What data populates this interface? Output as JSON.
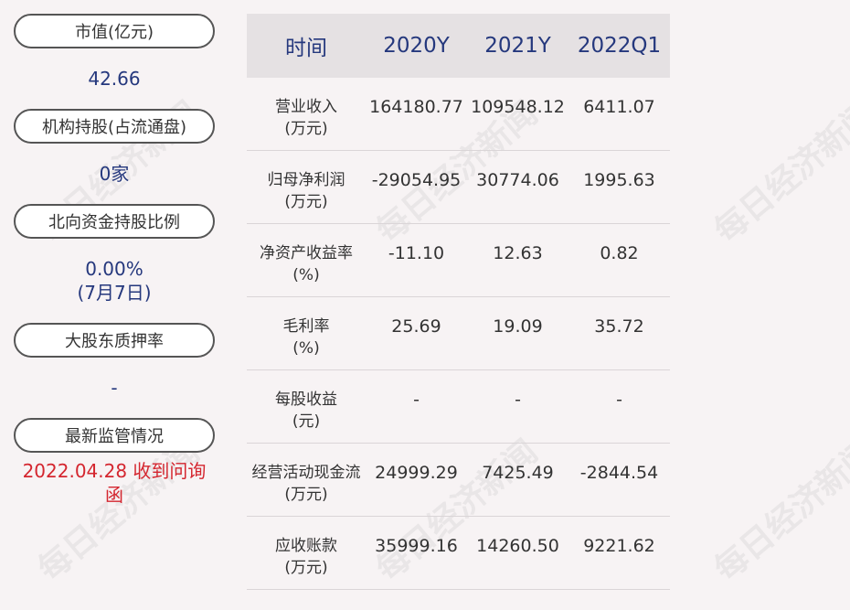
{
  "left": {
    "items": [
      {
        "label": "市值(亿元)",
        "value": "42.66"
      },
      {
        "label": "机构持股(占流通盘)",
        "value": "0家"
      },
      {
        "label": "北向资金持股比例",
        "value": "0.00%",
        "value2": "(7月7日)"
      },
      {
        "label": "大股东质押率",
        "value": "-"
      },
      {
        "label": "最新监管情况",
        "value": "2022.04.28 收到问询函"
      }
    ]
  },
  "table": {
    "headers": [
      "时间",
      "2020Y",
      "2021Y",
      "2022Q1"
    ],
    "rows": [
      {
        "label": "营业收入",
        "unit": "(万元)",
        "values": [
          "164180.77",
          "109548.12",
          "6411.07"
        ]
      },
      {
        "label": "归母净利润",
        "unit": "(万元)",
        "values": [
          "-29054.95",
          "30774.06",
          "1995.63"
        ]
      },
      {
        "label": "净资产收益率",
        "unit": "(%)",
        "values": [
          "-11.10",
          "12.63",
          "0.82"
        ]
      },
      {
        "label": "毛利率",
        "unit": "(%)",
        "values": [
          "25.69",
          "19.09",
          "35.72"
        ]
      },
      {
        "label": "每股收益",
        "unit": "(元)",
        "values": [
          "-",
          "-",
          "-"
        ]
      },
      {
        "label": "经营活动现金流",
        "unit": "(万元)",
        "values": [
          "24999.29",
          "7425.49",
          "-2844.54"
        ]
      },
      {
        "label": "应收账款",
        "unit": "(万元)",
        "values": [
          "35999.16",
          "14260.50",
          "9221.62"
        ]
      }
    ]
  },
  "watermark": "每日经济新闻",
  "colors": {
    "value_blue": "#25387d",
    "alert_red": "#d4262f",
    "header_bg": "#e5e1e3",
    "page_bg": "#f7f3f4"
  }
}
